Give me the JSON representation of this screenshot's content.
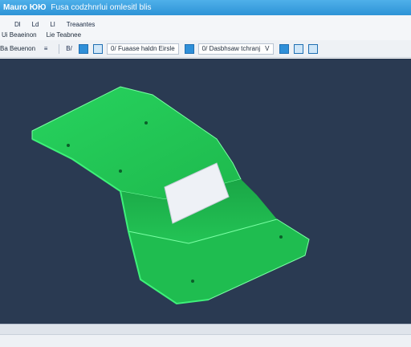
{
  "window": {
    "app_name": "Mauro ЮЮ",
    "doc_title": "Fusa codzhnrlui omlesitl blis"
  },
  "menubar": {
    "items": [
      {
        "label": "Dl"
      },
      {
        "label": "Ld"
      },
      {
        "label": "Ll"
      },
      {
        "label": "Treaantes"
      }
    ],
    "submenu_arrow": "˅"
  },
  "row2": {
    "items": [
      {
        "label": "Ui Beaeinon"
      },
      {
        "label": "Lie Teabnee"
      }
    ]
  },
  "toolbar": {
    "start_label": "Ba Beuenon",
    "btn_b": "B/",
    "dropdown1": {
      "prefix": "0/",
      "value": "Fuaase haldn Eirsle"
    },
    "dropdown2": {
      "prefix": "0/",
      "value": "Dasbhsaw tchranj"
    },
    "caret": "V"
  },
  "viewport": {
    "background": "#2a3a52",
    "model_color": "#22c455"
  }
}
